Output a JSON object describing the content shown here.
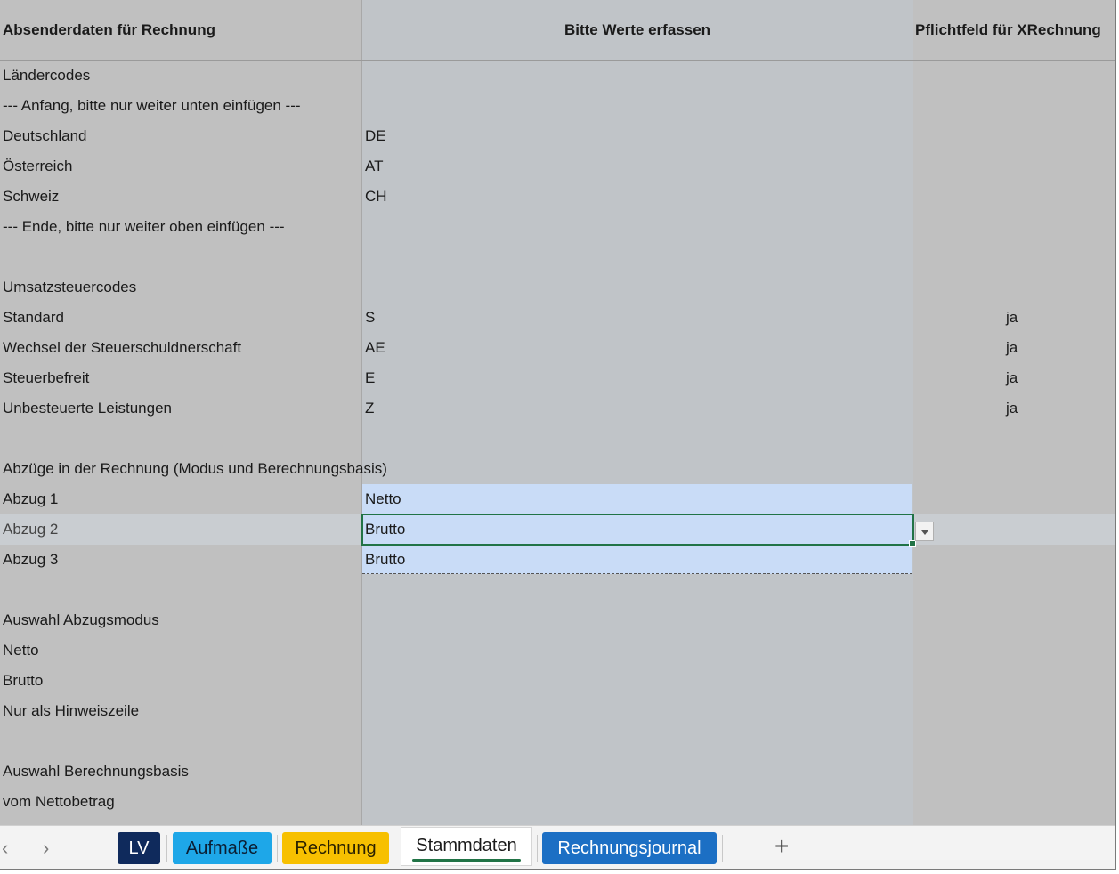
{
  "header": {
    "col_a": "Absenderdaten für Rechnung",
    "col_b": "Bitte Werte erfassen",
    "col_c": "Pflichtfeld für XRechnung"
  },
  "rows": [
    {
      "a": "Ländercodes",
      "b": "",
      "c": ""
    },
    {
      "a": "--- Anfang, bitte nur weiter unten einfügen ---",
      "b": "",
      "c": ""
    },
    {
      "a": "Deutschland",
      "b": "DE",
      "c": ""
    },
    {
      "a": "Österreich",
      "b": "AT",
      "c": ""
    },
    {
      "a": "Schweiz",
      "b": "CH",
      "c": ""
    },
    {
      "a": "--- Ende, bitte nur weiter oben einfügen  ---",
      "b": "",
      "c": ""
    },
    {
      "a": "",
      "b": "",
      "c": ""
    },
    {
      "a": "Umsatzsteuercodes",
      "b": "",
      "c": ""
    },
    {
      "a": "Standard",
      "b": "S",
      "c": "ja"
    },
    {
      "a": "Wechsel der Steuerschuldnerschaft",
      "b": "AE",
      "c": "ja"
    },
    {
      "a": "Steuerbefreit",
      "b": "E",
      "c": "ja"
    },
    {
      "a": "Unbesteuerte Leistungen",
      "b": "Z",
      "c": "ja"
    },
    {
      "a": "",
      "b": "",
      "c": ""
    },
    {
      "a": "Abzüge in der Rechnung (Modus und Berechnungsbasis)",
      "b": "",
      "c": ""
    },
    {
      "a": "Abzug 1",
      "b": "Netto",
      "c": ""
    },
    {
      "a": "Abzug 2",
      "b": "Brutto",
      "c": ""
    },
    {
      "a": "Abzug 3",
      "b": "Brutto",
      "c": ""
    },
    {
      "a": "",
      "b": "",
      "c": ""
    },
    {
      "a": "Auswahl Abzugsmodus",
      "b": "",
      "c": ""
    },
    {
      "a": "Netto",
      "b": "",
      "c": ""
    },
    {
      "a": "Brutto",
      "b": "",
      "c": ""
    },
    {
      "a": "Nur als Hinweiszeile",
      "b": "",
      "c": ""
    },
    {
      "a": "",
      "b": "",
      "c": ""
    },
    {
      "a": "Auswahl Berechnungsbasis",
      "b": "",
      "c": ""
    },
    {
      "a": "vom Nettobetrag",
      "b": "",
      "c": ""
    }
  ],
  "tabs": {
    "nav_prev": "‹",
    "nav_next": "›",
    "lv": "LV",
    "aufmasse": "Aufmaße",
    "rechnung": "Rechnung",
    "stammdaten": "Stammdaten",
    "journal": "Rechnungsjournal",
    "add": "+"
  },
  "colors": {
    "tab_lv": "#0f2a5c",
    "tab_aufmasse": "#1ea7e8",
    "tab_rechnung": "#f7c000",
    "tab_journal": "#1c6fc4",
    "selection": "#217346"
  }
}
